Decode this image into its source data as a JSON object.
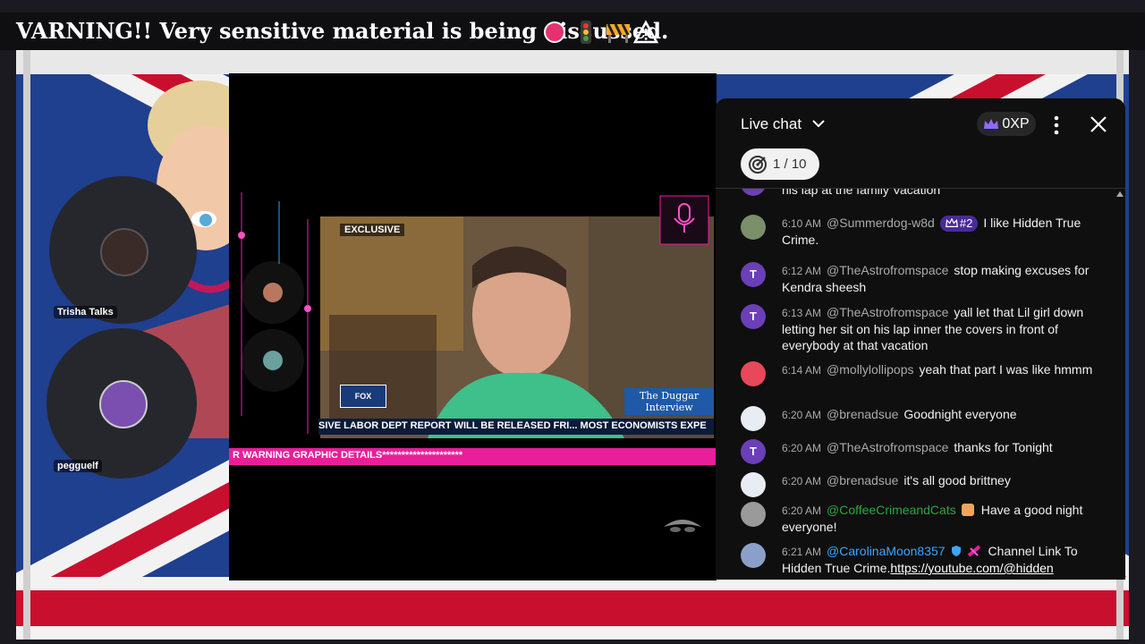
{
  "banner": {
    "text": "VARNING!! Very sensitive material is being discussed."
  },
  "stream": {
    "host_name": "Trisha Talks",
    "guest_name": "pegguelf",
    "mini_label": "EXCLUSIVE",
    "show_title": "The Duggar Interview",
    "ticker_text": "SIVE LABOR DEPT REPORT WILL BE RELEASED FRI... MOST ECONOMISTS EXPE",
    "warning_bar": "R WARNING GRAPHIC DETAILS*********************"
  },
  "chat": {
    "title": "Live chat",
    "xp_label": "0XP",
    "goal_label": "1 / 10",
    "messages": [
      {
        "time": "",
        "author": "",
        "text": "his lap at the family Vacation",
        "avatar_letter": "",
        "avatar_color": "#6b3fb8",
        "author_style": "grey"
      },
      {
        "time": "6:10 AM",
        "author": "@Summerdog-w8d",
        "badge": "#2",
        "text": "I like Hidden True Crime.",
        "avatar_letter": "",
        "avatar_color": "#7a8f6a",
        "author_style": "grey"
      },
      {
        "time": "6:12 AM",
        "author": "@TheAstrofromspace",
        "text": "stop making excuses for Kendra sheesh",
        "avatar_letter": "T",
        "avatar_color": "#6b3fb8",
        "author_style": "grey"
      },
      {
        "time": "6:13 AM",
        "author": "@TheAstrofromspace",
        "text": "yall let that Lil girl down letting her sit on his lap inner the covers in front of everybody at that vacation",
        "avatar_letter": "T",
        "avatar_color": "#6b3fb8",
        "author_style": "grey"
      },
      {
        "time": "6:14 AM",
        "author": "@mollylollipops",
        "text": "yeah that part I was like hmmm",
        "avatar_letter": "",
        "avatar_color": "#e8485a",
        "author_style": "grey"
      },
      {
        "time": "6:20 AM",
        "author": "@brenadsue",
        "text": "Goodnight everyone",
        "avatar_letter": "",
        "avatar_color": "#e9ecf2",
        "author_style": "grey"
      },
      {
        "time": "6:20 AM",
        "author": "@TheAstrofromspace",
        "text": "thanks for Tonight",
        "avatar_letter": "T",
        "avatar_color": "#6b3fb8",
        "author_style": "grey"
      },
      {
        "time": "6:20 AM",
        "author": "@brenadsue",
        "text": "it's all good brittney",
        "avatar_letter": "",
        "avatar_color": "#e9ecf2",
        "author_style": "grey"
      },
      {
        "time": "6:20 AM",
        "author": "@CoffeeCrimeandCats",
        "text": "Have a good night everyone!",
        "avatar_letter": "",
        "avatar_color": "#9a9a9a",
        "author_style": "green"
      },
      {
        "time": "6:21 AM",
        "author": "@CarolinaMoon8357",
        "text": "Channel Link To Hidden True Crime.",
        "link": "https://youtube.com/@hidden",
        "avatar_letter": "",
        "avatar_color": "#8aa0c8",
        "author_style": "blue"
      }
    ]
  },
  "colors": {
    "chat_bg": "#0f0f0f",
    "pink_accent": "#e81e9a",
    "flag_blue": "#1f3f8f",
    "flag_red": "#c8102e"
  }
}
